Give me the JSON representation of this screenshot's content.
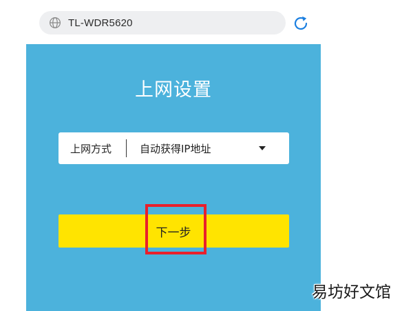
{
  "address_bar": {
    "url": "TL-WDR5620",
    "icon": "globe-icon",
    "reload_icon": "reload-icon"
  },
  "panel": {
    "title": "上网设置",
    "background": "#4cb2dc"
  },
  "connection_select": {
    "label": "上网方式",
    "value": "自动获得IP地址",
    "icon": "caret-down-icon"
  },
  "next_button": {
    "label": "下一步",
    "color": "#ffe400"
  },
  "highlight": {
    "color": "#e8202c"
  },
  "watermark": {
    "text": "易坊好文馆"
  }
}
